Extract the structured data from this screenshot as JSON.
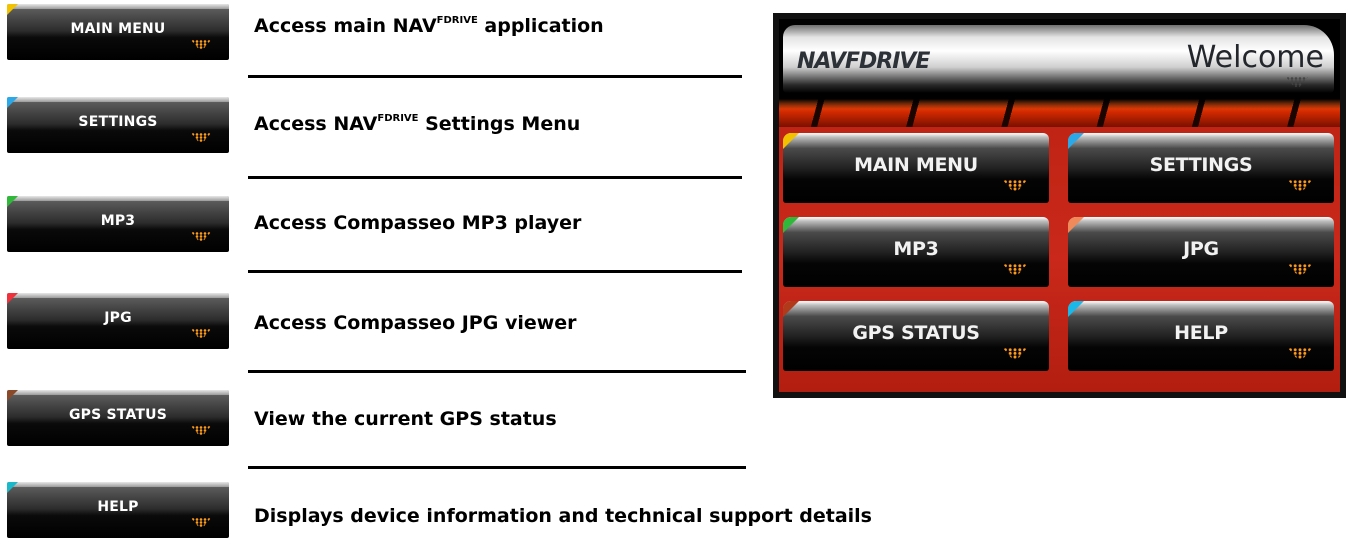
{
  "buttons": [
    {
      "label": "MAIN MENU",
      "accent": "#f2c200"
    },
    {
      "label": "SETTINGS",
      "accent": "#2aa8e8"
    },
    {
      "label": "MP3",
      "accent": "#2fb83a"
    },
    {
      "label": "JPG",
      "accent": "#f0303a"
    },
    {
      "label": "GPS STATUS",
      "accent": "#8a4a2a"
    },
    {
      "label": "HELP",
      "accent": "#1ab8c8"
    }
  ],
  "descriptions": [
    {
      "pre": "Access main NAV",
      "sup": "FDRIVE",
      "post": " application"
    },
    {
      "pre": "Access NAV",
      "sup": "FDRIVE",
      "post": " Settings Menu"
    },
    {
      "pre": "Access Compasseo MP3 player",
      "sup": "",
      "post": ""
    },
    {
      "pre": "Access Compasseo JPG viewer",
      "sup": "",
      "post": ""
    },
    {
      "pre": "View the current GPS status",
      "sup": "",
      "post": ""
    },
    {
      "pre": "Displays device information and technical support details",
      "sup": "",
      "post": ""
    }
  ],
  "screen": {
    "logo": "NAVFDRIVE",
    "welcome": "Welcome",
    "buttons": [
      {
        "label": "MAIN MENU",
        "accent": "#f2c200"
      },
      {
        "label": "SETTINGS",
        "accent": "#2aa8e8"
      },
      {
        "label": "MP3",
        "accent": "#2fb83a"
      },
      {
        "label": "JPG",
        "accent": "#f08a5a"
      },
      {
        "label": "GPS STATUS",
        "accent": "#b03a1a"
      },
      {
        "label": "HELP",
        "accent": "#1ab8e8"
      }
    ]
  }
}
